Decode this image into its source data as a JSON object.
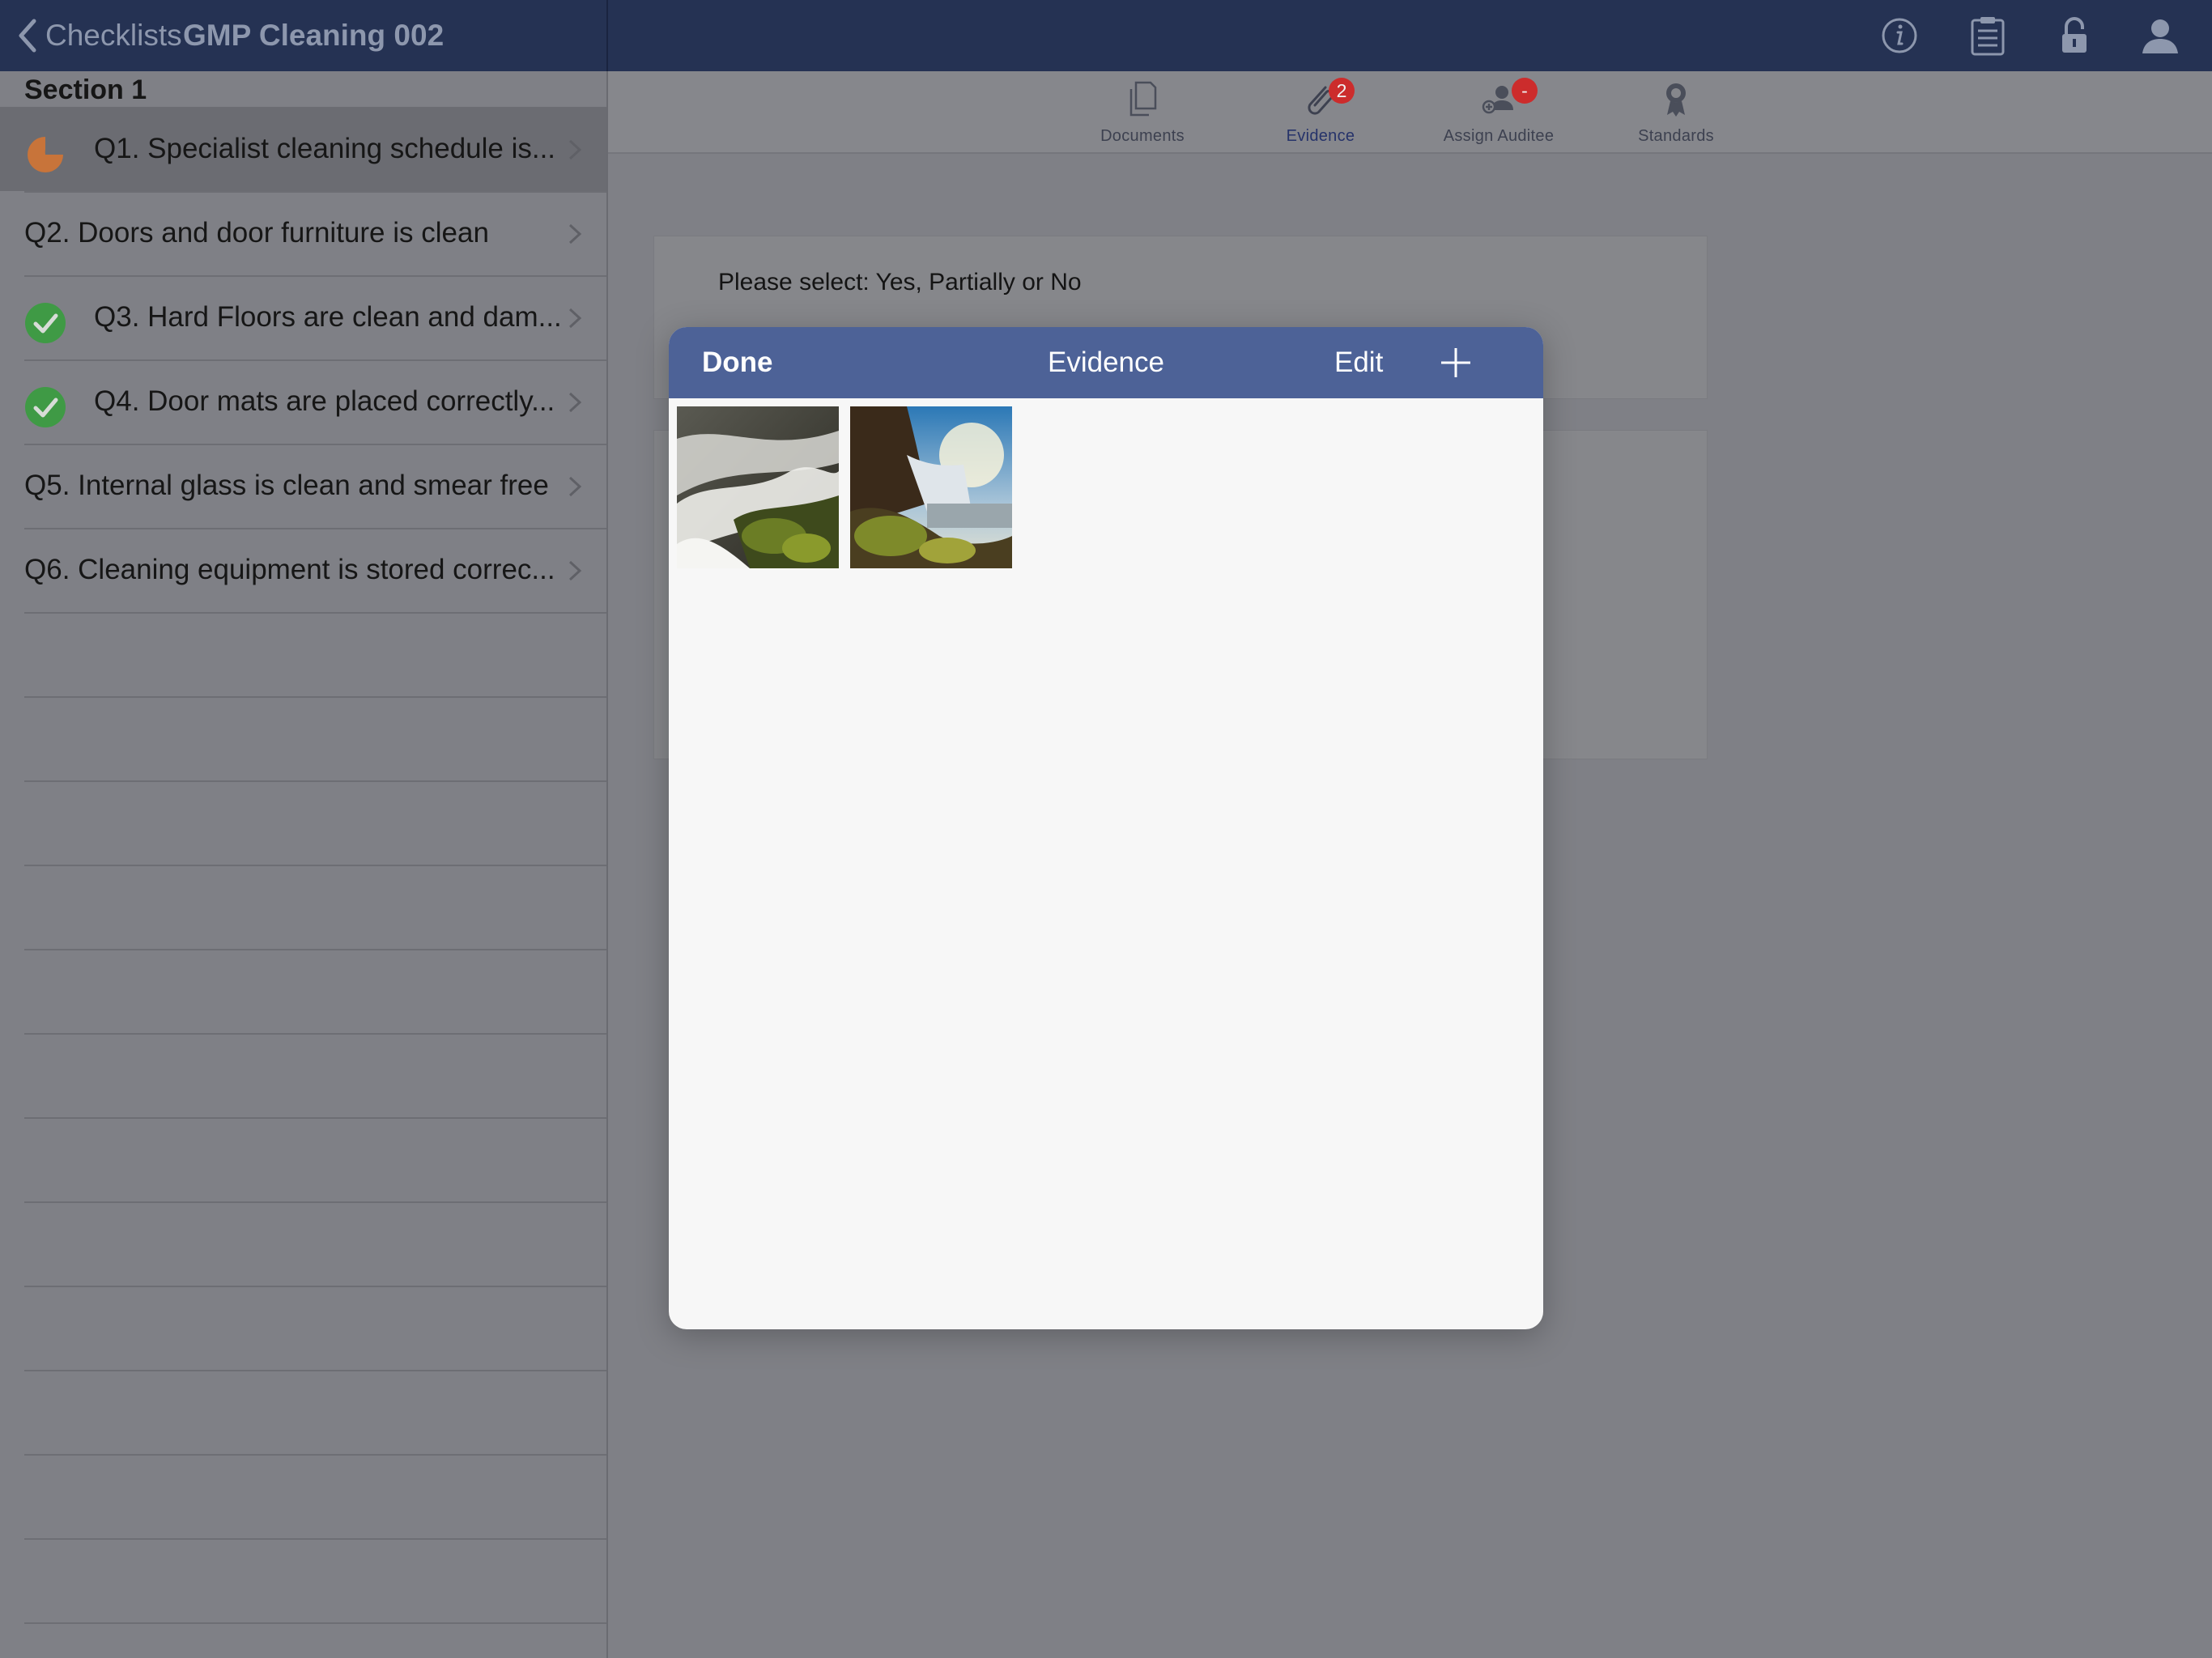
{
  "header": {
    "back_label": "Checklists",
    "title": "GMP Cleaning 002",
    "icons": [
      "info-icon",
      "clipboard-icon",
      "lock-icon",
      "user-icon"
    ]
  },
  "sidebar": {
    "section_title": "Section 1",
    "questions": [
      {
        "label": "Q1. Specialist cleaning schedule is...",
        "status": "partial",
        "selected": true
      },
      {
        "label": "Q2. Doors and door furniture is clean",
        "status": "none"
      },
      {
        "label": "Q3. Hard Floors are clean and dam...",
        "status": "complete"
      },
      {
        "label": "Q4. Door mats are placed correctly...",
        "status": "complete"
      },
      {
        "label": "Q5. Internal glass is clean and smear free",
        "status": "none"
      },
      {
        "label": "Q6. Cleaning equipment is stored correc...",
        "status": "none"
      }
    ]
  },
  "toolbar": {
    "items": [
      {
        "label": "Documents",
        "icon": "documents-icon"
      },
      {
        "label": "Evidence",
        "icon": "paperclip-icon",
        "badge": "2",
        "active": true
      },
      {
        "label": "Assign Auditee",
        "icon": "assign-user-icon",
        "badge": "-"
      },
      {
        "label": "Standards",
        "icon": "award-icon"
      }
    ]
  },
  "main": {
    "prompt": "Please select: Yes, Partially or No"
  },
  "modal": {
    "done_label": "Done",
    "title": "Evidence",
    "edit_label": "Edit",
    "add_icon": "plus-icon",
    "photos": [
      "waterfall-cascade-photo",
      "waterfall-cliff-photo"
    ]
  },
  "colors": {
    "topbar": "#253253",
    "modal_header": "#4d6297",
    "partial": "#c8743a",
    "complete": "#3f9a45",
    "badge": "#cc2c2c"
  }
}
